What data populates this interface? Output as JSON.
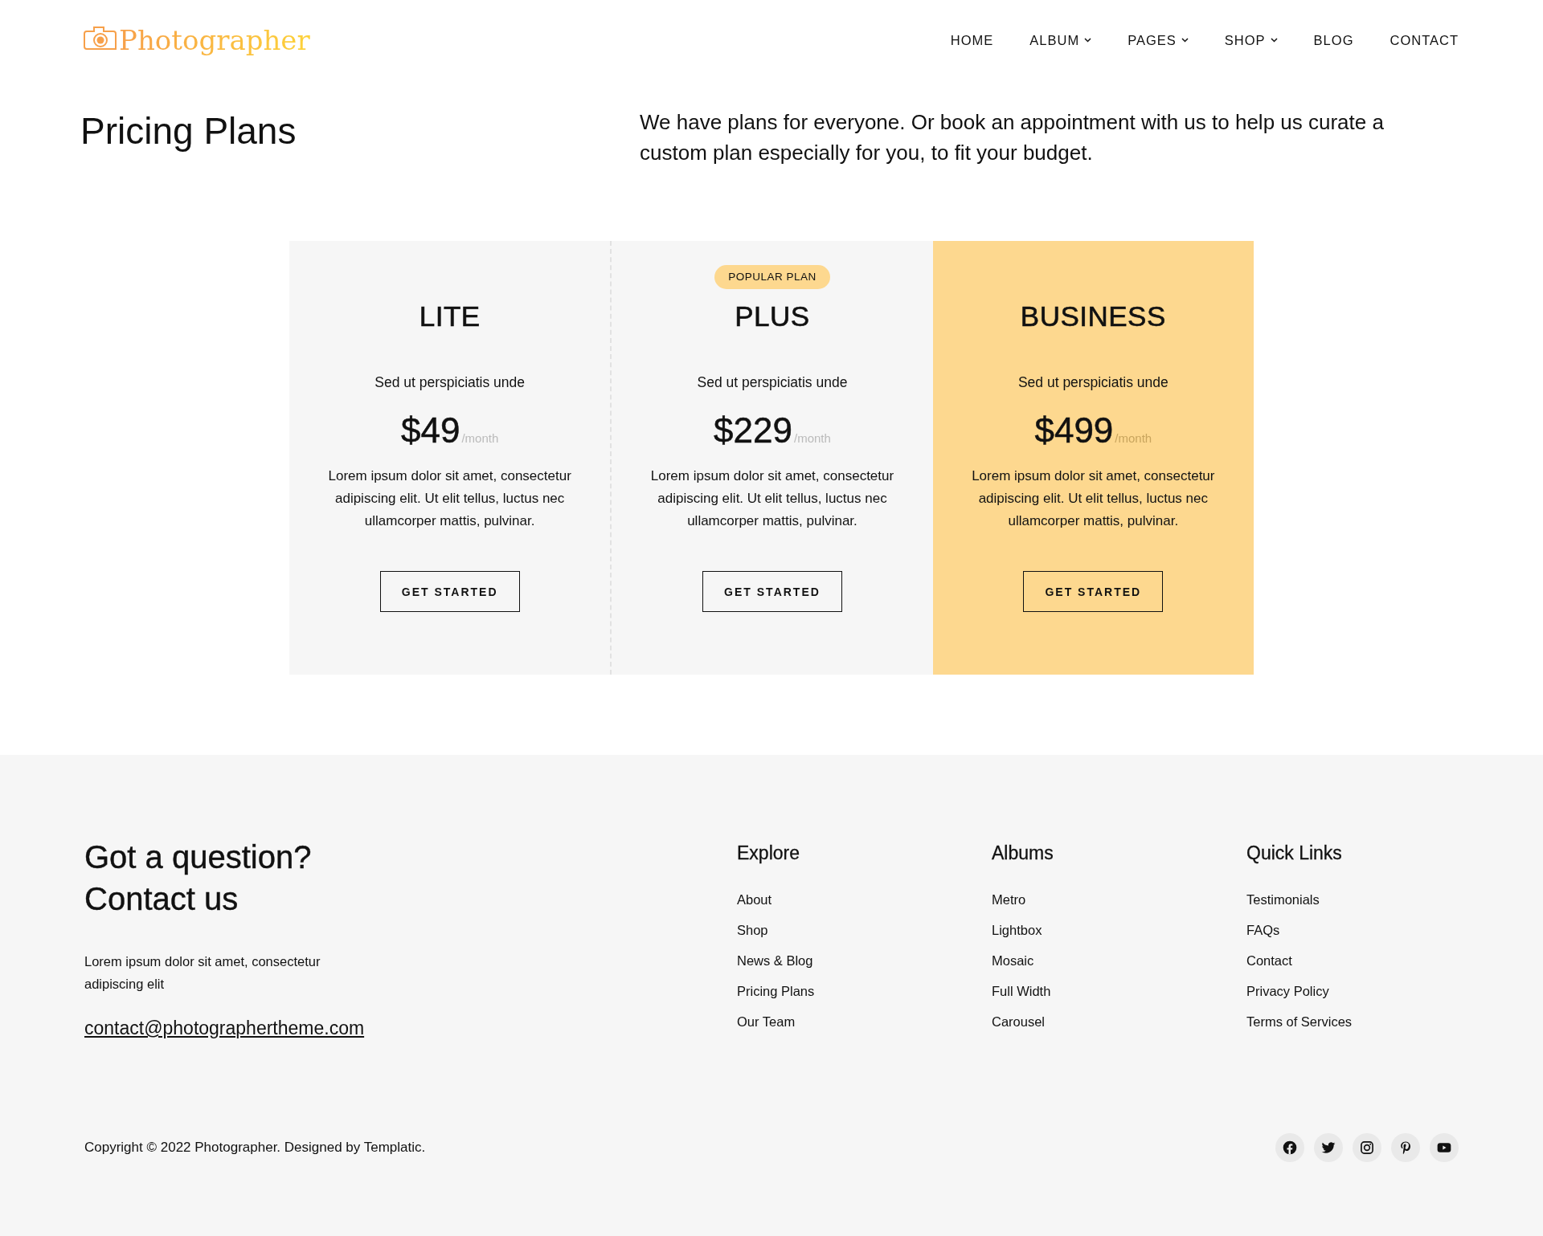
{
  "header": {
    "logo": "Photographer",
    "nav": [
      {
        "label": "HOME",
        "dropdown": false
      },
      {
        "label": "ALBUM",
        "dropdown": true
      },
      {
        "label": "PAGES",
        "dropdown": true
      },
      {
        "label": "SHOP",
        "dropdown": true
      },
      {
        "label": "BLOG",
        "dropdown": false
      },
      {
        "label": "CONTACT",
        "dropdown": false
      }
    ]
  },
  "hero": {
    "title": "Pricing Plans",
    "intro": "We have plans for everyone. Or book an appointment with us to help us curate a custom plan especially for you, to fit your budget."
  },
  "plans": [
    {
      "name": "LITE",
      "highlighted": false,
      "subtitle": "Sed ut perspiciatis unde",
      "price": "$49",
      "period": "/month",
      "description": "Lorem ipsum dolor sit amet, consectetur adipiscing elit. Ut elit tellus, luctus nec ullamcorper mattis, pulvinar.",
      "button": "GET STARTED"
    },
    {
      "name": "PLUS",
      "badge": "POPULAR PLAN",
      "highlighted": false,
      "subtitle": "Sed ut perspiciatis unde",
      "price": "$229",
      "period": "/month",
      "description": "Lorem ipsum dolor sit amet, consectetur adipiscing elit. Ut elit tellus, luctus nec ullamcorper mattis, pulvinar.",
      "button": "GET STARTED"
    },
    {
      "name": "BUSINESS",
      "highlighted": true,
      "subtitle": "Sed ut perspiciatis unde",
      "price": "$499",
      "period": "/month",
      "description": "Lorem ipsum dolor sit amet, consectetur adipiscing elit. Ut elit tellus, luctus nec ullamcorper mattis, pulvinar.",
      "button": "GET STARTED"
    }
  ],
  "footer": {
    "heading": [
      "Got a question?",
      "Contact us"
    ],
    "text": "Lorem ipsum dolor sit amet, consectetur adipiscing elit",
    "email": "contact@photographertheme.com",
    "columns": [
      {
        "title": "Explore",
        "links": [
          "About",
          "Shop",
          "News & Blog",
          "Pricing Plans",
          "Our Team"
        ]
      },
      {
        "title": "Albums",
        "links": [
          "Metro",
          "Lightbox",
          "Mosaic",
          "Full Width",
          "Carousel"
        ]
      },
      {
        "title": "Quick Links",
        "links": [
          "Testimonials",
          "FAQs",
          "Contact",
          "Privacy Policy",
          "Terms of Services"
        ]
      }
    ],
    "copyright": "Copyright © 2022 Photographer. Designed by Templatic.",
    "social": [
      {
        "kind": "facebook"
      },
      {
        "kind": "twitter"
      },
      {
        "kind": "instagram"
      },
      {
        "kind": "pinterest"
      },
      {
        "kind": "youtube"
      }
    ]
  }
}
